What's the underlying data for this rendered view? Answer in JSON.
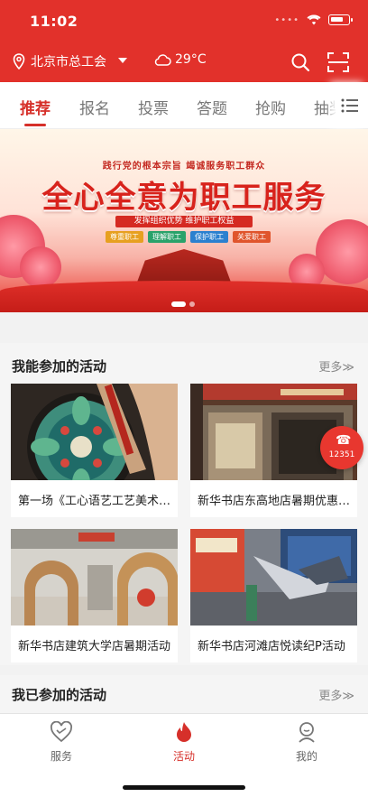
{
  "status_bar": {
    "time": "11:02"
  },
  "header": {
    "location": "北京市总工会",
    "temperature": "29°C",
    "icons": [
      "location-pin-icon",
      "cloud-icon",
      "search-icon",
      "scan-icon"
    ]
  },
  "tabs": [
    "推荐",
    "报名",
    "投票",
    "答题",
    "抢购",
    "抽奖"
  ],
  "banner": {
    "subtitle": "践行党的根本宗旨  竭诚服务职工群众",
    "title": "全心全意为职工服务",
    "slogan": "发挥组织优势 维护职工权益",
    "tags": [
      "尊重职工",
      "理解职工",
      "保护职工",
      "关爱职工"
    ],
    "pages": 2,
    "current_page": 1
  },
  "section_available": {
    "title": "我能参加的活动",
    "more": "更多≫",
    "items": [
      "第一场《工心语艺工艺美术沙龙》",
      "新华书店东高地店暑期优惠活动",
      "新华书店建筑大学店暑期活动",
      "新华书店河滩店悦读纪P活动"
    ]
  },
  "hotline": "12351",
  "section_joined": {
    "title": "我已参加的活动",
    "more": "更多≫"
  },
  "tabbar": [
    {
      "label": "服务",
      "icon": "heart-icon"
    },
    {
      "label": "活动",
      "icon": "flame-icon"
    },
    {
      "label": "我的",
      "icon": "user-icon"
    }
  ],
  "colors": {
    "primary": "#e2312b",
    "active": "#d6302a"
  }
}
